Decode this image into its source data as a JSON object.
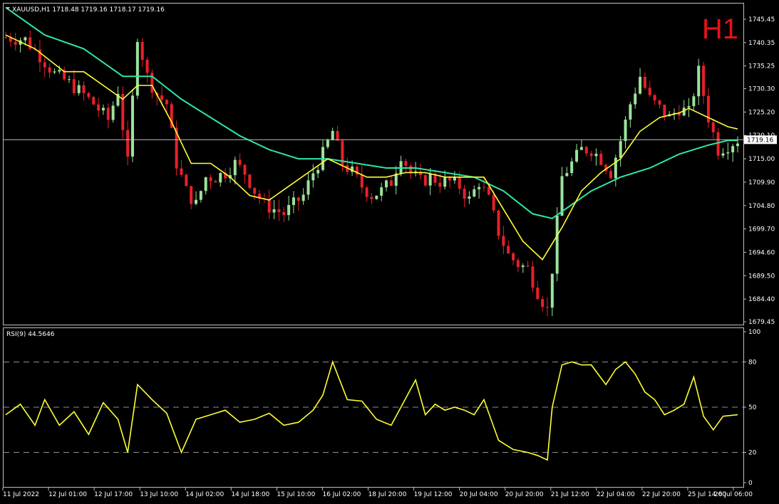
{
  "colors": {
    "background": "#000000",
    "frame": "#c0c0c0",
    "bull_candle": "#9be39b",
    "bear_candle": "#e8202a",
    "ma_fast": "#ffff33",
    "ma_slow": "#2ee6a8",
    "rsi_line": "#ffff33",
    "level_line": "#c0c0c0",
    "timeframe": "#e8101a"
  },
  "header": {
    "symbol_info": "XAUUSD,H1  1718.48 1719.16 1718.17 1719.16",
    "timeframe": "H1",
    "current_price": "1719.16"
  },
  "rsi_panel": {
    "label": "RSI(9) 44.5646"
  },
  "chart_data": [
    {
      "type": "candlestick",
      "symbol": "XAUUSD",
      "timeframe": "H1",
      "ylim": [
        1677.4,
        1748.4
      ],
      "y_ticks": [
        "1745.45",
        "1740.35",
        "1735.25",
        "1730.30",
        "1725.20",
        "1720.10",
        "1715.00",
        "1709.90",
        "1704.80",
        "1699.70",
        "1694.60",
        "1689.50",
        "1684.40",
        "1679.45"
      ],
      "x_ticks": [
        "11 Jul 2022",
        "12 Jul 01:00",
        "12 Jul 17:00",
        "13 Jul 10:00",
        "14 Jul 02:00",
        "14 Jul 18:00",
        "15 Jul 10:00",
        "16 Jul 02:00",
        "18 Jul 20:00",
        "19 Jul 12:00",
        "20 Jul 04:00",
        "20 Jul 20:00",
        "21 Jul 12:00",
        "22 Jul 04:00",
        "22 Jul 20:00",
        "25 Jul 14:00",
        "26 Jul 06:00"
      ],
      "current_price": 1719.16,
      "close_path": [
        [
          0,
          1741.5
        ],
        [
          4,
          1741
        ],
        [
          7,
          1737.5
        ],
        [
          10,
          1733.5
        ],
        [
          13,
          1731.5
        ],
        [
          16,
          1729
        ],
        [
          18,
          1727
        ],
        [
          21,
          1723.5
        ],
        [
          23,
          1730
        ],
        [
          25,
          1714
        ],
        [
          27,
          1742
        ],
        [
          29,
          1733
        ],
        [
          31,
          1729
        ],
        [
          33,
          1727
        ],
        [
          35,
          1714
        ],
        [
          37,
          1708
        ],
        [
          39,
          1705
        ],
        [
          41,
          1711
        ],
        [
          43,
          1711
        ],
        [
          45,
          1712
        ],
        [
          47,
          1714
        ],
        [
          49,
          1712
        ],
        [
          51,
          1708
        ],
        [
          53,
          1705
        ],
        [
          55,
          1704
        ],
        [
          57,
          1703
        ],
        [
          59,
          1705
        ],
        [
          61,
          1707
        ],
        [
          63,
          1712
        ],
        [
          65,
          1716
        ],
        [
          67,
          1721
        ],
        [
          69,
          1714
        ],
        [
          71,
          1712
        ],
        [
          73,
          1709
        ],
        [
          75,
          1707
        ],
        [
          77,
          1708
        ],
        [
          79,
          1710
        ],
        [
          81,
          1716
        ],
        [
          83,
          1712
        ],
        [
          85,
          1710
        ],
        [
          87,
          1711
        ],
        [
          89,
          1710
        ],
        [
          91,
          1710
        ],
        [
          93,
          1709
        ],
        [
          95,
          1706
        ],
        [
          97,
          1710
        ],
        [
          99,
          1706
        ],
        [
          101,
          1699
        ],
        [
          103,
          1694
        ],
        [
          105,
          1692
        ],
        [
          107,
          1691
        ],
        [
          109,
          1686
        ],
        [
          111,
          1682
        ],
        [
          112,
          1691
        ],
        [
          114,
          1711
        ],
        [
          116,
          1714
        ],
        [
          118,
          1717
        ],
        [
          120,
          1717
        ],
        [
          122,
          1715
        ],
        [
          124,
          1712
        ],
        [
          126,
          1719
        ],
        [
          128,
          1727
        ],
        [
          130,
          1733
        ],
        [
          132,
          1728
        ],
        [
          134,
          1726
        ],
        [
          136,
          1724
        ],
        [
          138,
          1726
        ],
        [
          140,
          1725
        ],
        [
          142,
          1734
        ],
        [
          144,
          1724
        ],
        [
          146,
          1717
        ],
        [
          148,
          1718
        ],
        [
          150,
          1719.16
        ]
      ],
      "ma_fast": [
        [
          0,
          1742
        ],
        [
          6,
          1739
        ],
        [
          12,
          1734
        ],
        [
          16,
          1734
        ],
        [
          20,
          1731
        ],
        [
          24,
          1728
        ],
        [
          27,
          1731
        ],
        [
          30,
          1731
        ],
        [
          34,
          1723
        ],
        [
          38,
          1714
        ],
        [
          42,
          1714
        ],
        [
          46,
          1711
        ],
        [
          50,
          1707
        ],
        [
          54,
          1706
        ],
        [
          58,
          1709
        ],
        [
          62,
          1712
        ],
        [
          66,
          1715
        ],
        [
          70,
          1713
        ],
        [
          74,
          1711
        ],
        [
          78,
          1711
        ],
        [
          82,
          1712
        ],
        [
          86,
          1712
        ],
        [
          90,
          1711
        ],
        [
          94,
          1711
        ],
        [
          98,
          1711
        ],
        [
          102,
          1704
        ],
        [
          106,
          1697
        ],
        [
          110,
          1693
        ],
        [
          114,
          1700
        ],
        [
          118,
          1708
        ],
        [
          122,
          1712
        ],
        [
          126,
          1715
        ],
        [
          130,
          1721
        ],
        [
          134,
          1724
        ],
        [
          138,
          1725
        ],
        [
          140,
          1726
        ],
        [
          144,
          1724
        ],
        [
          148,
          1722
        ],
        [
          150,
          1721.5
        ]
      ],
      "ma_slow": [
        [
          0,
          1748
        ],
        [
          8,
          1742
        ],
        [
          16,
          1739
        ],
        [
          24,
          1733
        ],
        [
          30,
          1733
        ],
        [
          36,
          1728
        ],
        [
          42,
          1724
        ],
        [
          48,
          1720
        ],
        [
          54,
          1717
        ],
        [
          60,
          1715
        ],
        [
          66,
          1715
        ],
        [
          72,
          1714
        ],
        [
          78,
          1713
        ],
        [
          84,
          1713
        ],
        [
          90,
          1712
        ],
        [
          96,
          1711
        ],
        [
          102,
          1708
        ],
        [
          108,
          1703
        ],
        [
          112,
          1702
        ],
        [
          116,
          1705
        ],
        [
          120,
          1708
        ],
        [
          126,
          1711
        ],
        [
          132,
          1713
        ],
        [
          138,
          1716
        ],
        [
          144,
          1718
        ],
        [
          148,
          1719
        ],
        [
          150,
          1719
        ]
      ]
    },
    {
      "type": "line",
      "name": "RSI(9)",
      "current_value": 44.5646,
      "ylim": [
        0,
        100
      ],
      "y_ticks": [
        100,
        80,
        50,
        20,
        0
      ],
      "levels": [
        80,
        50,
        20
      ],
      "values": [
        [
          0,
          45
        ],
        [
          3,
          52
        ],
        [
          6,
          38
        ],
        [
          8,
          55
        ],
        [
          11,
          38
        ],
        [
          14,
          47
        ],
        [
          17,
          32
        ],
        [
          20,
          53
        ],
        [
          23,
          42
        ],
        [
          25,
          20
        ],
        [
          27,
          65
        ],
        [
          30,
          55
        ],
        [
          33,
          46
        ],
        [
          36,
          20
        ],
        [
          39,
          42
        ],
        [
          42,
          45
        ],
        [
          45,
          48
        ],
        [
          48,
          40
        ],
        [
          51,
          42
        ],
        [
          54,
          46
        ],
        [
          57,
          38
        ],
        [
          60,
          40
        ],
        [
          63,
          48
        ],
        [
          65,
          58
        ],
        [
          67,
          80
        ],
        [
          70,
          55
        ],
        [
          73,
          54
        ],
        [
          76,
          42
        ],
        [
          79,
          38
        ],
        [
          82,
          56
        ],
        [
          84,
          68
        ],
        [
          86,
          45
        ],
        [
          88,
          52
        ],
        [
          90,
          48
        ],
        [
          92,
          50
        ],
        [
          94,
          48
        ],
        [
          96,
          45
        ],
        [
          98,
          55
        ],
        [
          101,
          28
        ],
        [
          104,
          22
        ],
        [
          107,
          20
        ],
        [
          109,
          18
        ],
        [
          111,
          15
        ],
        [
          112,
          50
        ],
        [
          114,
          78
        ],
        [
          116,
          80
        ],
        [
          118,
          78
        ],
        [
          120,
          78
        ],
        [
          123,
          65
        ],
        [
          125,
          75
        ],
        [
          127,
          80
        ],
        [
          129,
          72
        ],
        [
          131,
          60
        ],
        [
          133,
          55
        ],
        [
          135,
          45
        ],
        [
          137,
          48
        ],
        [
          139,
          52
        ],
        [
          141,
          70
        ],
        [
          143,
          44
        ],
        [
          145,
          35
        ],
        [
          147,
          44
        ],
        [
          150,
          45
        ]
      ]
    }
  ]
}
